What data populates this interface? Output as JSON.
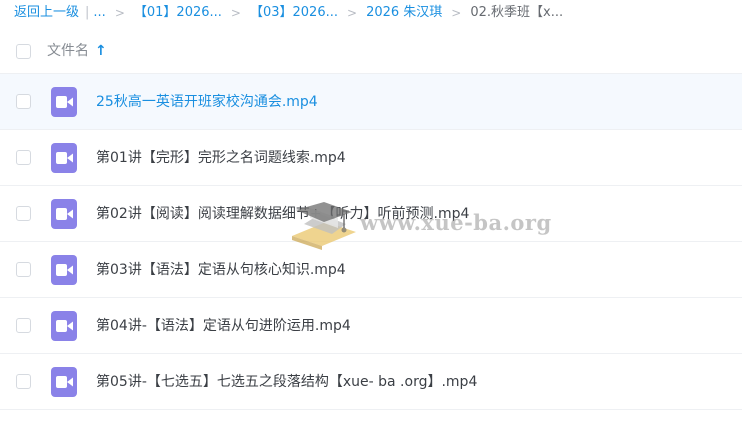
{
  "breadcrumb": {
    "back_label": "返回上一级",
    "pipe": "|",
    "ellipsis": "...",
    "separator": ">",
    "items": [
      "【01】2026...",
      "【03】2026...",
      "2026 朱汉琪"
    ],
    "current": "02.秋季班【x..."
  },
  "header": {
    "column_name": "文件名",
    "sort_glyph": "↑"
  },
  "files": [
    {
      "name": "25秋高一英语开班家校沟通会.mp4"
    },
    {
      "name": "第01讲【完形】完形之名词题线索.mp4"
    },
    {
      "name": "第02讲【阅读】阅读理解数据细节+【听力】听前预测.mp4"
    },
    {
      "name": "第03讲【语法】定语从句核心知识.mp4"
    },
    {
      "name": "第04讲-【语法】定语从句进阶运用.mp4"
    },
    {
      "name": "第05讲-【七选五】七选五之段落结构【xue- ba .org】.mp4"
    }
  ],
  "watermark": {
    "text": "www.xue-ba.org"
  },
  "colors": {
    "accent": "#1a8fe0",
    "video_icon": "#8a82e8",
    "hover_row": "#f5f9fe"
  },
  "icons": {
    "sort": "arrow-up-icon",
    "file": "video-file-icon"
  }
}
